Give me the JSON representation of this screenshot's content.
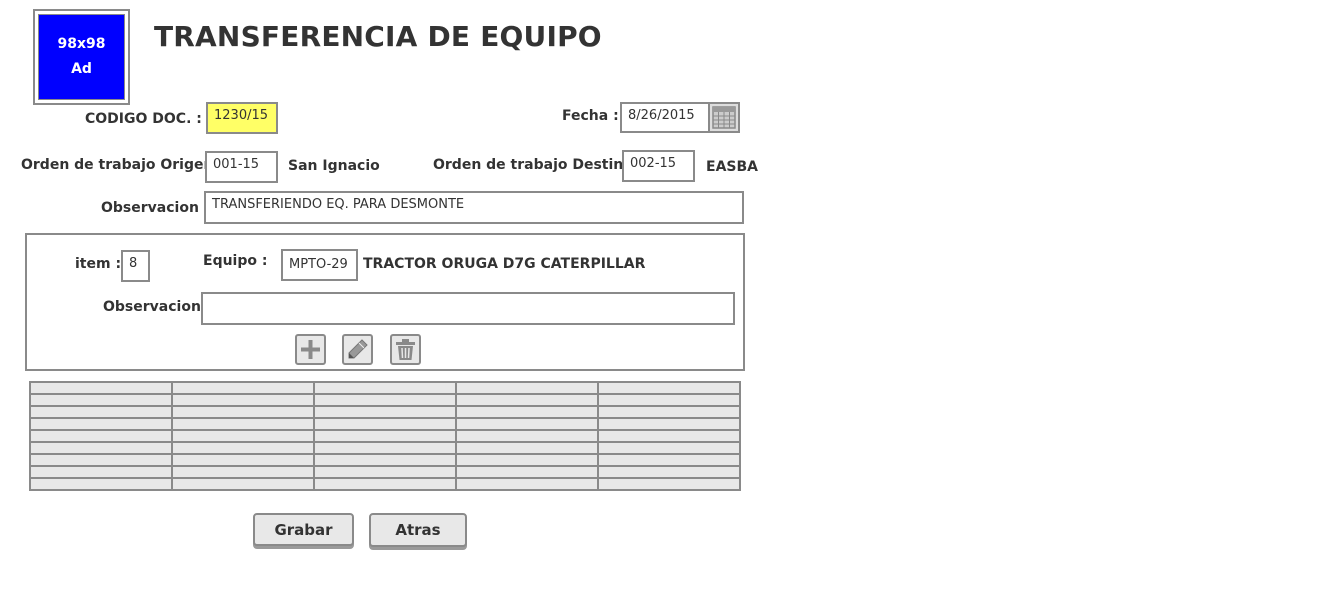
{
  "ad": {
    "line1": "98x98",
    "line2": "Ad"
  },
  "title": "TRANSFERENCIA DE EQUIPO",
  "codigo": {
    "label": "CODIGO DOC. :",
    "value": "1230/15"
  },
  "fecha": {
    "label": "Fecha :",
    "value": "8/26/2015",
    "icon": "calendar-icon"
  },
  "origen": {
    "label": "Orden de trabajo Origen :",
    "value": "001-15",
    "name": "San Ignacio"
  },
  "destino": {
    "label": "Orden de trabajo Destino :",
    "value": "002-15",
    "name": "EASBA"
  },
  "observacion": {
    "label": "Observacion :",
    "value": "TRANSFERIENDO EQ. PARA DESMONTE"
  },
  "item_panel": {
    "item_label": "item :",
    "item_value": "8",
    "equipo_label": "Equipo :",
    "equipo_code": "MPTO-29",
    "equipo_desc": "TRACTOR ORUGA D7G CATERPILLAR",
    "obs_label": "Observacion :",
    "obs_value": "",
    "actions": [
      {
        "icon": "plus-icon"
      },
      {
        "icon": "pencil-icon"
      },
      {
        "icon": "trash-icon"
      }
    ]
  },
  "buttons": {
    "save": "Grabar",
    "back": "Atras"
  },
  "colors": {
    "ad_blue": "#0000ff",
    "highlight_yellow": "#ffff66",
    "border_gray": "#8a8a8a",
    "cell_gray": "#e8e8e8"
  }
}
